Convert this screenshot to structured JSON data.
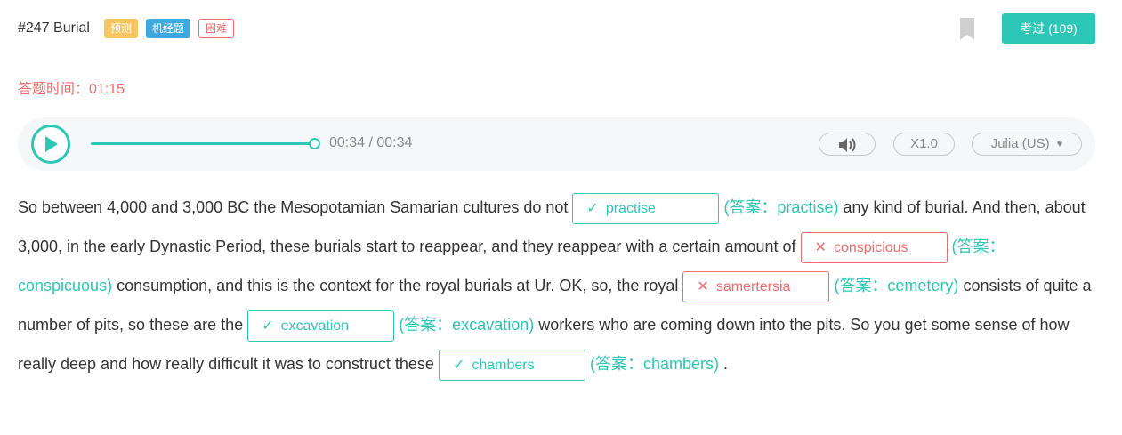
{
  "header": {
    "question_title": "#247 Burial",
    "tags": [
      "预测",
      "机经题",
      "困难"
    ],
    "exam_button_label": "考过 (109)"
  },
  "timer": {
    "label": "答题时间：01:15"
  },
  "player": {
    "time_text": "00:34 / 00:34",
    "progress": 1.0,
    "speed_label": "X1.0",
    "voice_label": "Julia (US)",
    "voice_arrow": "♥"
  },
  "passage": {
    "t1": "So between 4,000 and 3,000 BC the Mesopotamian Samarian cultures do not",
    "b1": {
      "status": "correct",
      "mark": "✓",
      "value": "practise",
      "answer": "(答案：practise)"
    },
    "t2": "any kind of burial. And then, about 3,000, in the early Dynastic Period, these burials start to reappear, and they reappear with a certain amount of",
    "b2": {
      "status": "wrong",
      "mark": "✕",
      "value": "conspicious",
      "answer": "(答案：conspicuous)"
    },
    "t3": "consumption, and this is the context for the royal burials at Ur. OK, so, the royal",
    "b3": {
      "status": "wrong",
      "mark": "✕",
      "value": "samertersia",
      "answer": "(答案：cemetery)"
    },
    "t4": "consists of quite a number of pits, so these are the",
    "b4": {
      "status": "correct",
      "mark": "✓",
      "value": "excavation",
      "answer": "(答案：excavation)"
    },
    "t5": "workers who are coming down into the pits. So you get some sense of how really deep and how really difficult it was to construct these",
    "b5": {
      "status": "correct",
      "mark": "✓",
      "value": "chambers",
      "answer": "(答案：chambers)"
    },
    "t6": "."
  },
  "colors": {
    "accent": "#2cc7b6",
    "error": "#ee6c6c",
    "tag_yellow": "#f8c55e",
    "tag_blue": "#3ea9de"
  },
  "icons": {
    "play": "play-icon",
    "volume": "volume-icon",
    "bookmark": "bookmark-icon"
  }
}
